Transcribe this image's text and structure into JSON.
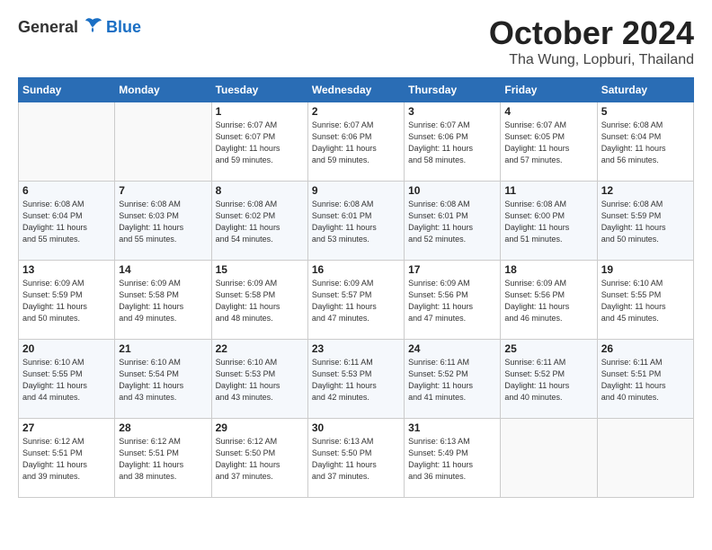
{
  "header": {
    "logo_general": "General",
    "logo_blue": "Blue",
    "month": "October 2024",
    "location": "Tha Wung, Lopburi, Thailand"
  },
  "days_of_week": [
    "Sunday",
    "Monday",
    "Tuesday",
    "Wednesday",
    "Thursday",
    "Friday",
    "Saturday"
  ],
  "weeks": [
    [
      {
        "day": "",
        "info": ""
      },
      {
        "day": "",
        "info": ""
      },
      {
        "day": "1",
        "info": "Sunrise: 6:07 AM\nSunset: 6:07 PM\nDaylight: 11 hours\nand 59 minutes."
      },
      {
        "day": "2",
        "info": "Sunrise: 6:07 AM\nSunset: 6:06 PM\nDaylight: 11 hours\nand 59 minutes."
      },
      {
        "day": "3",
        "info": "Sunrise: 6:07 AM\nSunset: 6:06 PM\nDaylight: 11 hours\nand 58 minutes."
      },
      {
        "day": "4",
        "info": "Sunrise: 6:07 AM\nSunset: 6:05 PM\nDaylight: 11 hours\nand 57 minutes."
      },
      {
        "day": "5",
        "info": "Sunrise: 6:08 AM\nSunset: 6:04 PM\nDaylight: 11 hours\nand 56 minutes."
      }
    ],
    [
      {
        "day": "6",
        "info": "Sunrise: 6:08 AM\nSunset: 6:04 PM\nDaylight: 11 hours\nand 55 minutes."
      },
      {
        "day": "7",
        "info": "Sunrise: 6:08 AM\nSunset: 6:03 PM\nDaylight: 11 hours\nand 55 minutes."
      },
      {
        "day": "8",
        "info": "Sunrise: 6:08 AM\nSunset: 6:02 PM\nDaylight: 11 hours\nand 54 minutes."
      },
      {
        "day": "9",
        "info": "Sunrise: 6:08 AM\nSunset: 6:01 PM\nDaylight: 11 hours\nand 53 minutes."
      },
      {
        "day": "10",
        "info": "Sunrise: 6:08 AM\nSunset: 6:01 PM\nDaylight: 11 hours\nand 52 minutes."
      },
      {
        "day": "11",
        "info": "Sunrise: 6:08 AM\nSunset: 6:00 PM\nDaylight: 11 hours\nand 51 minutes."
      },
      {
        "day": "12",
        "info": "Sunrise: 6:08 AM\nSunset: 5:59 PM\nDaylight: 11 hours\nand 50 minutes."
      }
    ],
    [
      {
        "day": "13",
        "info": "Sunrise: 6:09 AM\nSunset: 5:59 PM\nDaylight: 11 hours\nand 50 minutes."
      },
      {
        "day": "14",
        "info": "Sunrise: 6:09 AM\nSunset: 5:58 PM\nDaylight: 11 hours\nand 49 minutes."
      },
      {
        "day": "15",
        "info": "Sunrise: 6:09 AM\nSunset: 5:58 PM\nDaylight: 11 hours\nand 48 minutes."
      },
      {
        "day": "16",
        "info": "Sunrise: 6:09 AM\nSunset: 5:57 PM\nDaylight: 11 hours\nand 47 minutes."
      },
      {
        "day": "17",
        "info": "Sunrise: 6:09 AM\nSunset: 5:56 PM\nDaylight: 11 hours\nand 47 minutes."
      },
      {
        "day": "18",
        "info": "Sunrise: 6:09 AM\nSunset: 5:56 PM\nDaylight: 11 hours\nand 46 minutes."
      },
      {
        "day": "19",
        "info": "Sunrise: 6:10 AM\nSunset: 5:55 PM\nDaylight: 11 hours\nand 45 minutes."
      }
    ],
    [
      {
        "day": "20",
        "info": "Sunrise: 6:10 AM\nSunset: 5:55 PM\nDaylight: 11 hours\nand 44 minutes."
      },
      {
        "day": "21",
        "info": "Sunrise: 6:10 AM\nSunset: 5:54 PM\nDaylight: 11 hours\nand 43 minutes."
      },
      {
        "day": "22",
        "info": "Sunrise: 6:10 AM\nSunset: 5:53 PM\nDaylight: 11 hours\nand 43 minutes."
      },
      {
        "day": "23",
        "info": "Sunrise: 6:11 AM\nSunset: 5:53 PM\nDaylight: 11 hours\nand 42 minutes."
      },
      {
        "day": "24",
        "info": "Sunrise: 6:11 AM\nSunset: 5:52 PM\nDaylight: 11 hours\nand 41 minutes."
      },
      {
        "day": "25",
        "info": "Sunrise: 6:11 AM\nSunset: 5:52 PM\nDaylight: 11 hours\nand 40 minutes."
      },
      {
        "day": "26",
        "info": "Sunrise: 6:11 AM\nSunset: 5:51 PM\nDaylight: 11 hours\nand 40 minutes."
      }
    ],
    [
      {
        "day": "27",
        "info": "Sunrise: 6:12 AM\nSunset: 5:51 PM\nDaylight: 11 hours\nand 39 minutes."
      },
      {
        "day": "28",
        "info": "Sunrise: 6:12 AM\nSunset: 5:51 PM\nDaylight: 11 hours\nand 38 minutes."
      },
      {
        "day": "29",
        "info": "Sunrise: 6:12 AM\nSunset: 5:50 PM\nDaylight: 11 hours\nand 37 minutes."
      },
      {
        "day": "30",
        "info": "Sunrise: 6:13 AM\nSunset: 5:50 PM\nDaylight: 11 hours\nand 37 minutes."
      },
      {
        "day": "31",
        "info": "Sunrise: 6:13 AM\nSunset: 5:49 PM\nDaylight: 11 hours\nand 36 minutes."
      },
      {
        "day": "",
        "info": ""
      },
      {
        "day": "",
        "info": ""
      }
    ]
  ]
}
